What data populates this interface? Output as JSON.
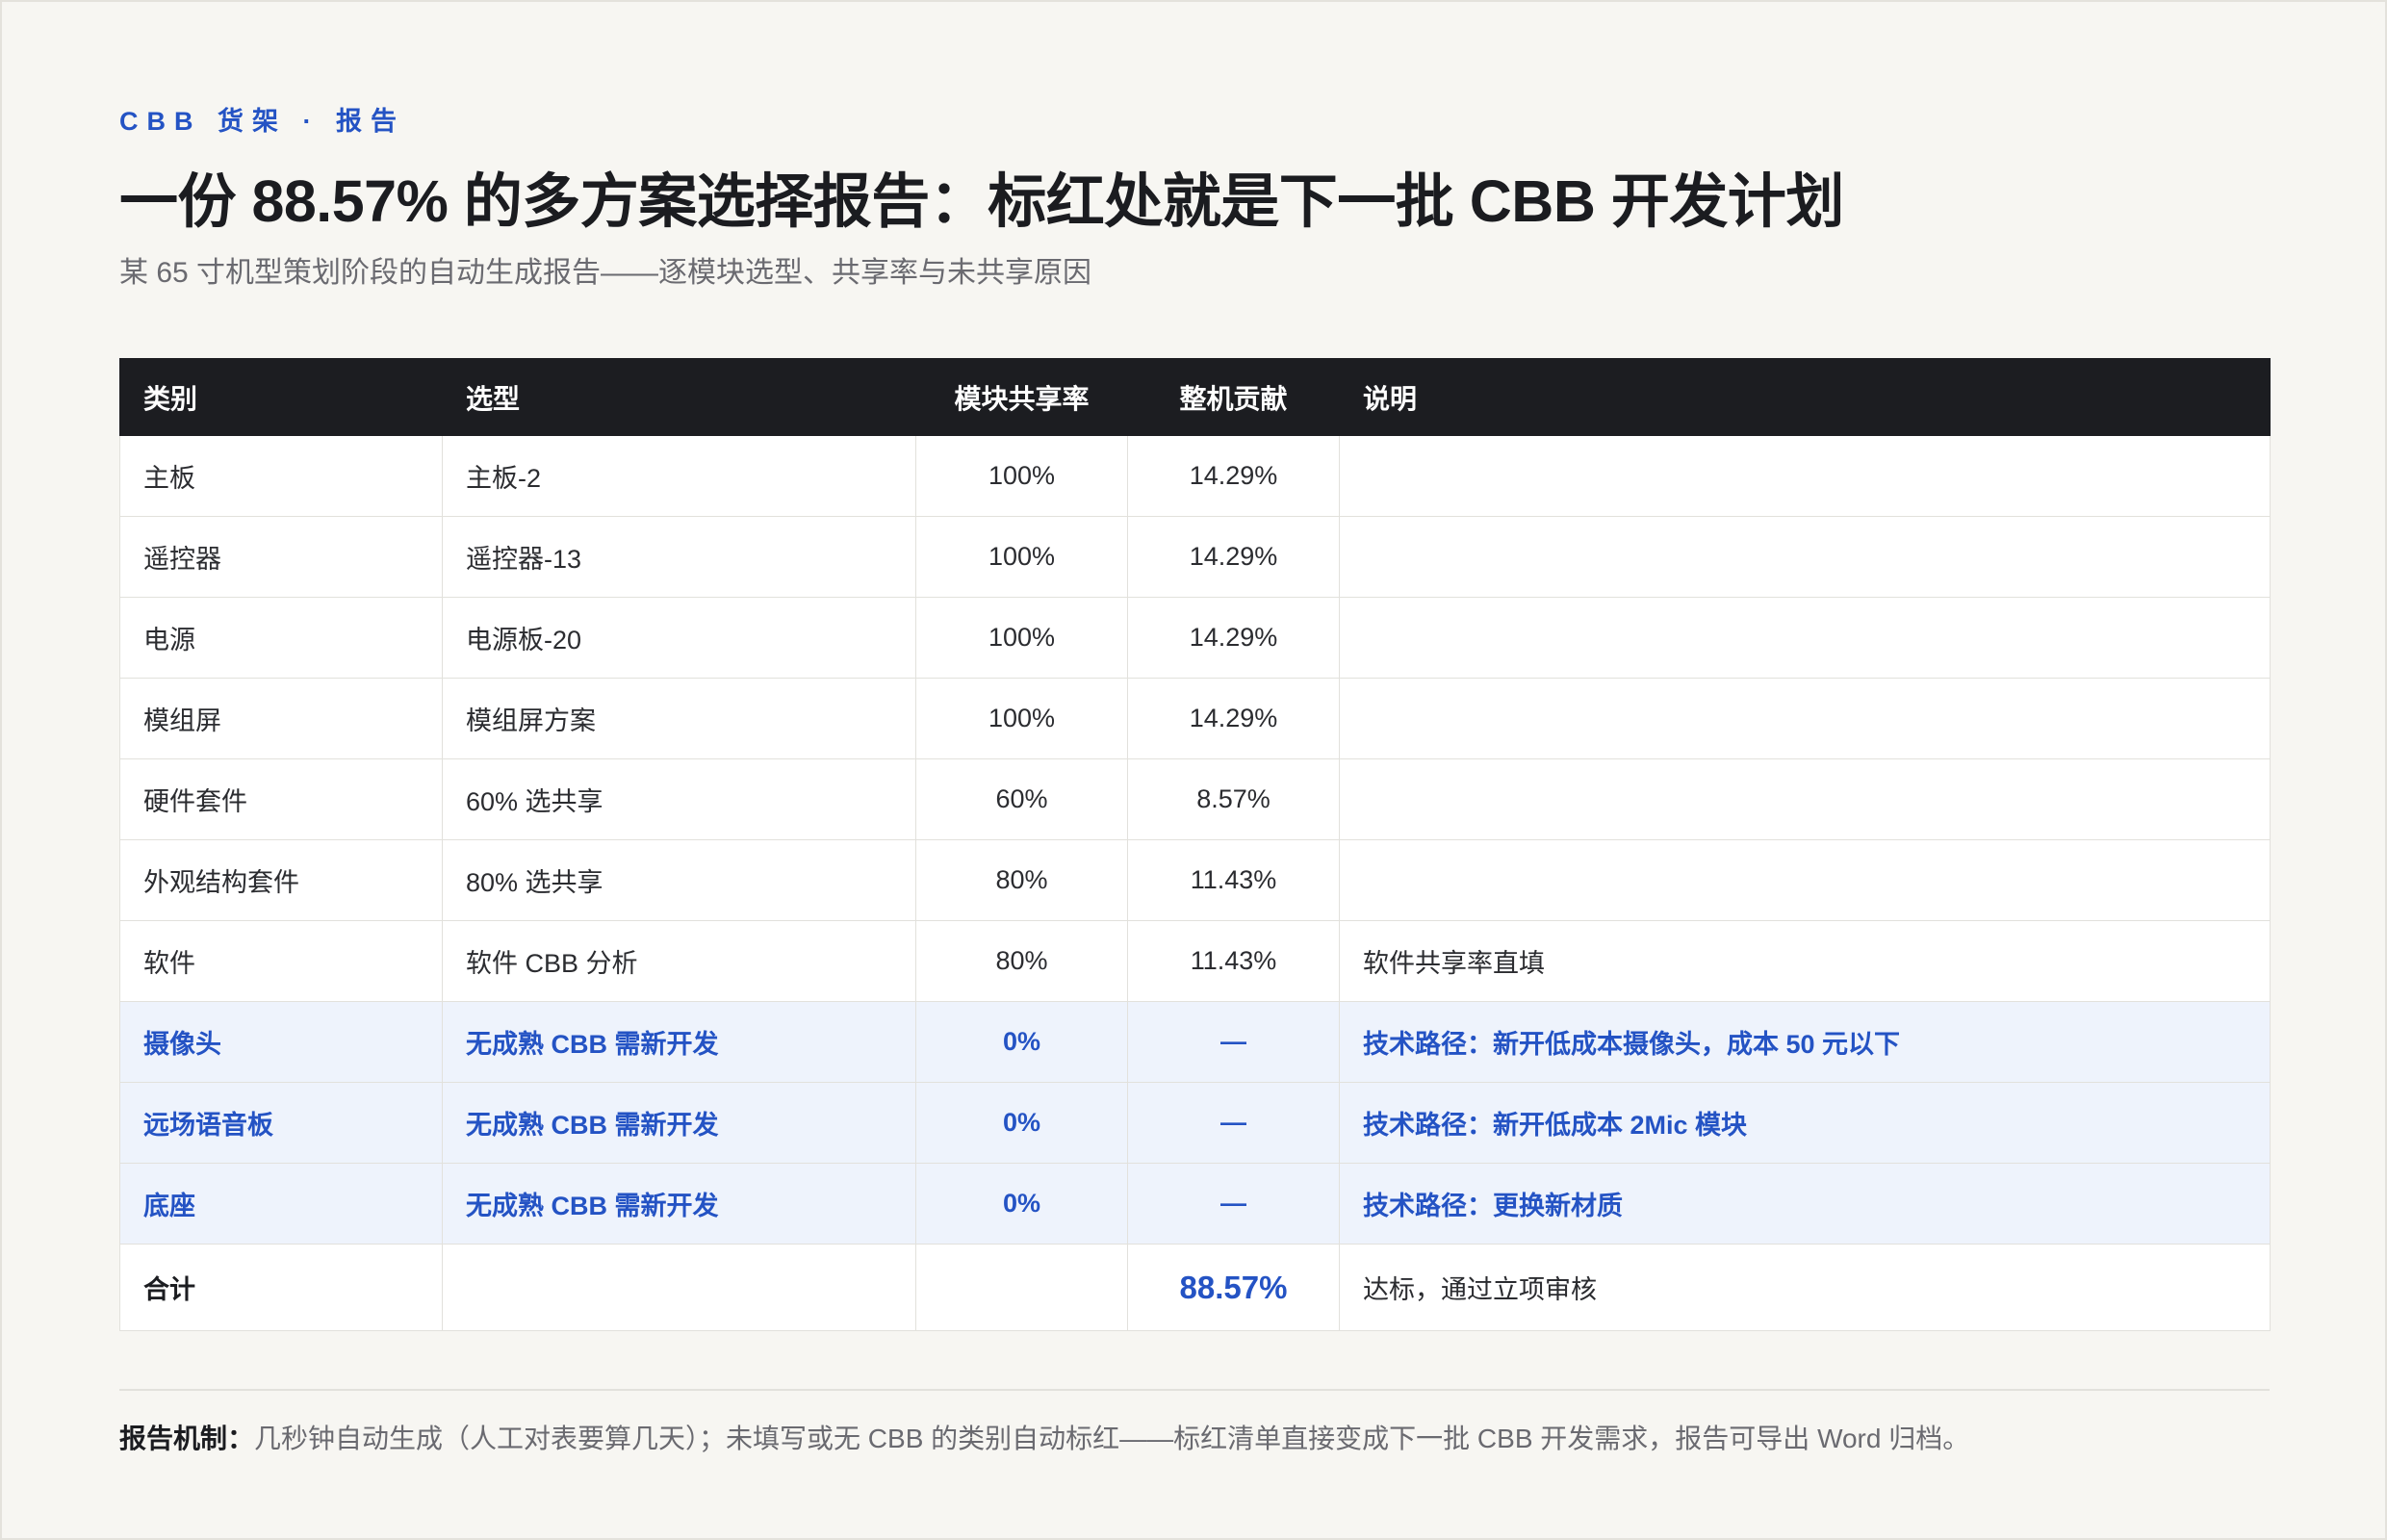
{
  "header": {
    "eyebrow": "CBB 货架 · 报告",
    "title": "一份 88.57% 的多方案选择报告：标红处就是下一批 CBB 开发计划",
    "subtitle": "某 65 寸机型策划阶段的自动生成报告——逐模块选型、共享率与未共享原因"
  },
  "table": {
    "columns": [
      "类别",
      "选型",
      "模块共享率",
      "整机贡献",
      "说明"
    ],
    "rows": [
      {
        "category": "主板",
        "choice": "主板-2",
        "share": "100%",
        "contrib": "14.29%",
        "note": "",
        "flag": false
      },
      {
        "category": "遥控器",
        "choice": "遥控器-13",
        "share": "100%",
        "contrib": "14.29%",
        "note": "",
        "flag": false
      },
      {
        "category": "电源",
        "choice": "电源板-20",
        "share": "100%",
        "contrib": "14.29%",
        "note": "",
        "flag": false
      },
      {
        "category": "模组屏",
        "choice": "模组屏方案",
        "share": "100%",
        "contrib": "14.29%",
        "note": "",
        "flag": false
      },
      {
        "category": "硬件套件",
        "choice": "60% 选共享",
        "share": "60%",
        "contrib": "8.57%",
        "note": "",
        "flag": false
      },
      {
        "category": "外观结构套件",
        "choice": "80% 选共享",
        "share": "80%",
        "contrib": "11.43%",
        "note": "",
        "flag": false
      },
      {
        "category": "软件",
        "choice": "软件 CBB 分析",
        "share": "80%",
        "contrib": "11.43%",
        "note": "软件共享率直填",
        "flag": false
      },
      {
        "category": "摄像头",
        "choice": "无成熟 CBB 需新开发",
        "share": "0%",
        "contrib": "—",
        "note": "技术路径：新开低成本摄像头，成本 50 元以下",
        "flag": true
      },
      {
        "category": "远场语音板",
        "choice": "无成熟 CBB 需新开发",
        "share": "0%",
        "contrib": "—",
        "note": "技术路径：新开低成本 2Mic 模块",
        "flag": true
      },
      {
        "category": "底座",
        "choice": "无成熟 CBB 需新开发",
        "share": "0%",
        "contrib": "—",
        "note": "技术路径：更换新材质",
        "flag": true
      }
    ],
    "total": {
      "label": "合计",
      "value": "88.57%",
      "note": "达标，通过立项审核"
    }
  },
  "footer": {
    "label": "报告机制：",
    "text": "几秒钟自动生成（人工对表要算几天）；未填写或无 CBB 的类别自动标红——标红清单直接变成下一批 CBB 开发需求，报告可导出 Word 归档。"
  },
  "colors": {
    "accent": "#2453c4",
    "header_bg": "#1c1d21",
    "flag_row_bg": "#eef3fc"
  }
}
